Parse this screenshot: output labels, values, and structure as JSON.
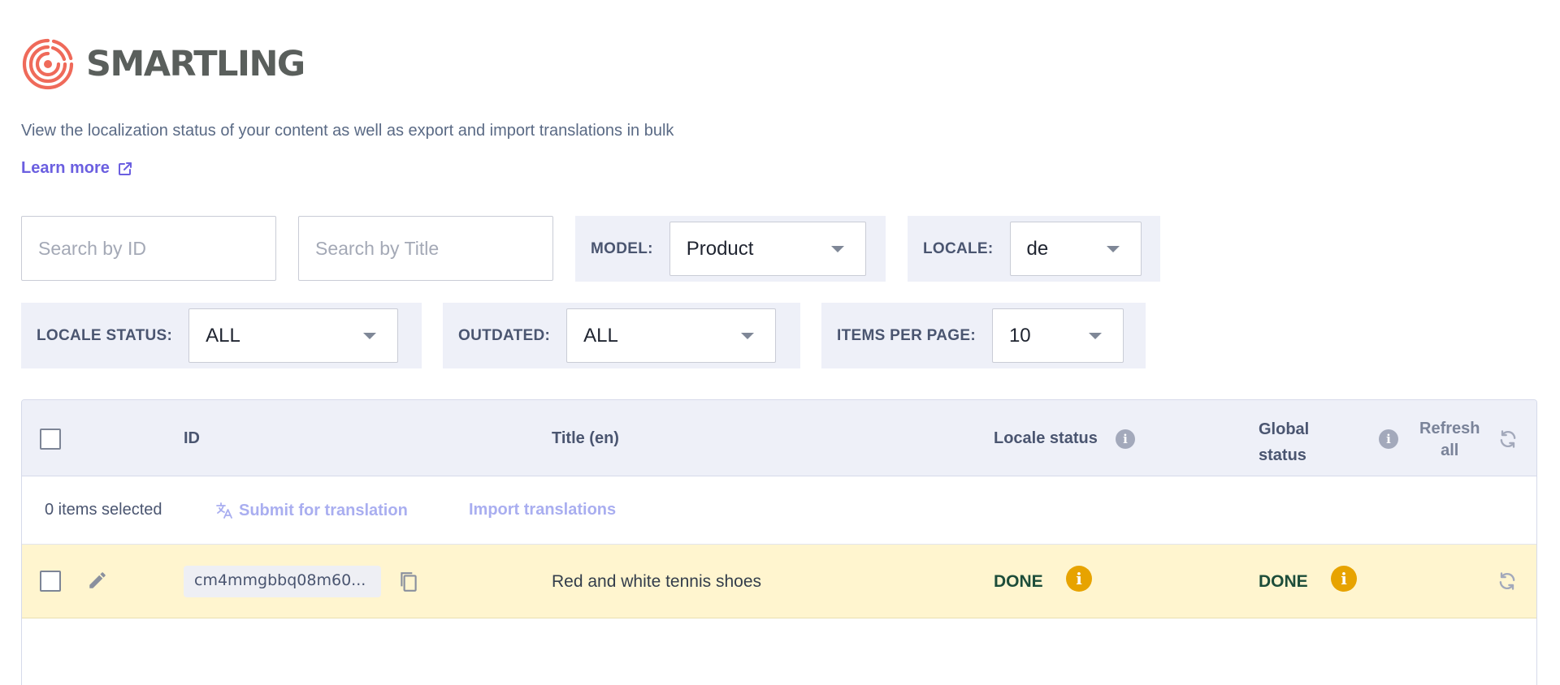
{
  "brand": {
    "name": "SMARTLING",
    "logo_icon": "smartling-logo-icon",
    "accent": "#ef6a5a"
  },
  "intro": {
    "description": "View the localization status of your content as well as export and import translations in bulk",
    "learn_more": "Learn more"
  },
  "filters": {
    "search_id_placeholder": "Search by ID",
    "search_title_placeholder": "Search by Title",
    "model": {
      "label": "MODEL:",
      "value": "Product"
    },
    "locale": {
      "label": "LOCALE:",
      "value": "de"
    },
    "locale_status": {
      "label": "LOCALE STATUS:",
      "value": "ALL"
    },
    "outdated": {
      "label": "OUTDATED:",
      "value": "ALL"
    },
    "items_per_page": {
      "label": "ITEMS PER PAGE:",
      "value": "10"
    }
  },
  "table": {
    "headers": {
      "id": "ID",
      "title": "Title (en)",
      "locale_status": "Locale status",
      "global_status_line1": "Global",
      "global_status_line2": "status",
      "refresh_line1": "Refresh",
      "refresh_line2": "all"
    },
    "actions": {
      "selected": "0 items selected",
      "submit": "Submit for translation",
      "import": "Import translations"
    },
    "rows": [
      {
        "id": "cm4mmgbbq08m60...",
        "title": "Red and white tennis shoes",
        "locale_status": "DONE",
        "global_status": "DONE",
        "info_glyph": "i"
      }
    ],
    "info_glyph": "i"
  }
}
